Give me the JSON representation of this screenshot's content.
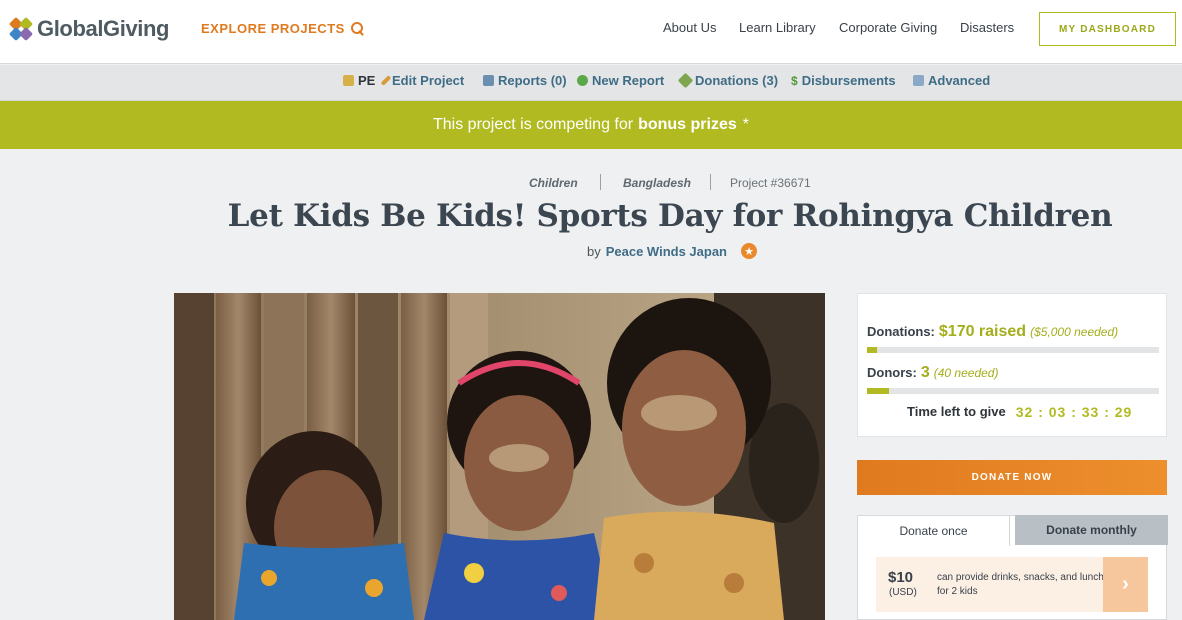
{
  "header": {
    "logo_text": "GlobalGiving",
    "explore_label": "EXPLORE PROJECTS",
    "nav": [
      "About Us",
      "Learn Library",
      "Corporate Giving",
      "Disasters"
    ],
    "dashboard_label": "MY DASHBOARD"
  },
  "admin": {
    "pe_label": "PE",
    "items": [
      {
        "label": "Edit Project",
        "icon": "pencil-icon"
      },
      {
        "label": "Reports (0)",
        "icon": "reports-icon"
      },
      {
        "label": "New Report",
        "icon": "plus-circle-icon"
      },
      {
        "label": "Donations (3)",
        "icon": "tag-icon"
      },
      {
        "label": "Disbursements",
        "icon": "dollar-icon"
      },
      {
        "label": "Advanced",
        "icon": "notepad-icon"
      }
    ]
  },
  "banner": {
    "text": "This project is competing for",
    "bold": "bonus prizes",
    "suffix": "*"
  },
  "project": {
    "theme": "Children",
    "country": "Bangladesh",
    "number": "Project #36671",
    "title": "Let Kids Be Kids! Sports Day for Rohingya Children",
    "by_label": "by",
    "org": "Peace Winds Japan"
  },
  "stats": {
    "donations_label": "Donations:",
    "raised": "$170 raised",
    "goal": "($5,000 needed)",
    "donations_progress": 0.034,
    "donors_label": "Donors:",
    "donors_count": "3",
    "donors_needed": "(40 needed)",
    "donors_progress": 0.075,
    "time_label": "Time left to give",
    "time_value": "32 : 03 : 33 : 29"
  },
  "donate": {
    "button_label": "DONATE NOW",
    "tab_once": "Donate once",
    "tab_monthly": "Donate monthly",
    "option_amount": "$10",
    "option_currency": "(USD)",
    "option_desc": "can provide drinks, snacks, and lunch for 2 kids",
    "option_arrow": "›"
  },
  "colors": {
    "accent_green": "#b1bb21",
    "accent_orange": "#e07a1f",
    "link_blue": "#3f6c86"
  }
}
